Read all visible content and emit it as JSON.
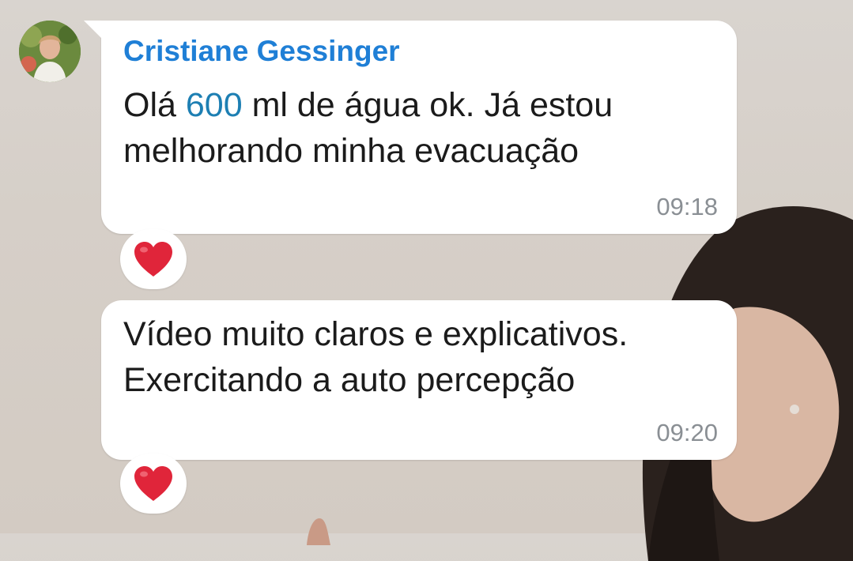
{
  "messages": [
    {
      "sender": "Cristiane Gessinger",
      "text_line1_before": "Olá ",
      "text_line1_number": "600",
      "text_line1_after": " ml de água ok. Já estou",
      "text_line2": "melhorando minha evacuação",
      "time": "09:18",
      "reaction": "heart-icon"
    },
    {
      "text_line1": "Vídeo muito claros e explicativos.",
      "text_line2": "Exercitando a auto percepção",
      "time": "09:20",
      "reaction": "heart-icon"
    }
  ],
  "colors": {
    "sender_name": "#1f7fd6",
    "number_link": "#1d7fb3",
    "heart": "#e0253a",
    "timestamp": "#8a8f94"
  }
}
